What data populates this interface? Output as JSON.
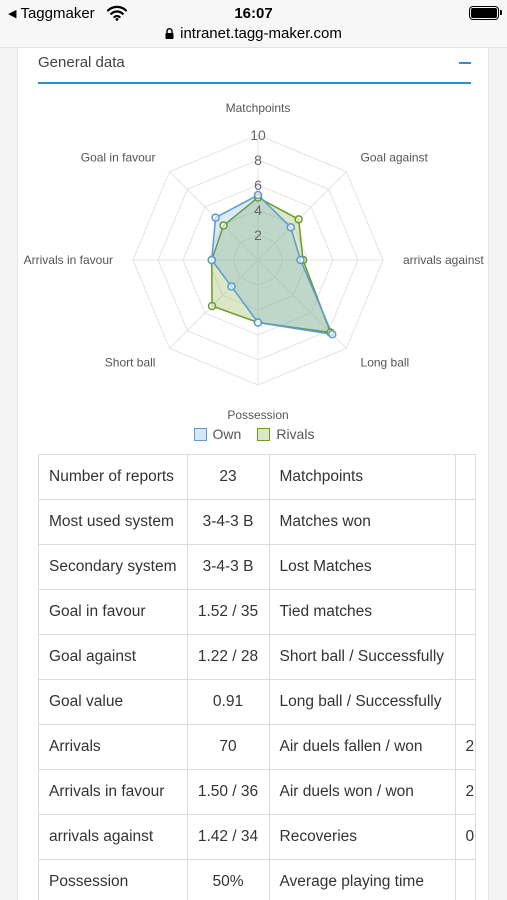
{
  "status_bar": {
    "back_label": "Taggmaker",
    "time": "16:07",
    "url": "intranet.tagg-maker.com"
  },
  "panel": {
    "title": "General data",
    "toggle_icon": "minus-icon"
  },
  "colors": {
    "accent": "#2b8fd6",
    "own": "#5b9bd5",
    "rivals": "#6a9a2a"
  },
  "chart_data": {
    "type": "radar",
    "axes": [
      "Matchpoints",
      "Goal against",
      "arrivals against",
      "Long ball",
      "Possession",
      "Short ball",
      "Arrivals in favour",
      "Goal in favour"
    ],
    "ticks": [
      "2",
      "4",
      "6",
      "8",
      "10"
    ],
    "rmax": 10,
    "series": [
      {
        "name": "Own",
        "values": [
          5.2,
          3.7,
          3.4,
          8.4,
          5.0,
          3.0,
          3.7,
          4.8
        ]
      },
      {
        "name": "Rivals",
        "values": [
          5.0,
          4.6,
          3.6,
          8.2,
          5.0,
          5.2,
          3.7,
          3.9
        ]
      }
    ],
    "grid": true,
    "legend_position": "bottom"
  },
  "table": {
    "rows": [
      [
        "Number of reports",
        "23",
        "Matchpoints",
        ""
      ],
      [
        "Most used system",
        "3-4-3 B",
        "Matches won",
        ""
      ],
      [
        "Secondary system",
        "3-4-3 B",
        "Lost Matches",
        ""
      ],
      [
        "Goal in favour",
        "1.52 / 35",
        "Tied matches",
        ""
      ],
      [
        "Goal against",
        "1.22 / 28",
        "Short ball / Successfully",
        ""
      ],
      [
        "Goal value",
        "0.91",
        "Long ball / Successfully",
        ""
      ],
      [
        "Arrivals",
        "70",
        "Air duels fallen / won",
        "2"
      ],
      [
        "Arrivals in favour",
        "1.50 / 36",
        "Air duels won / won",
        "2"
      ],
      [
        "arrivals against",
        "1.42 / 34",
        "Recoveries",
        "0"
      ],
      [
        "Possession",
        "50%",
        "Average playing time",
        ""
      ]
    ]
  }
}
